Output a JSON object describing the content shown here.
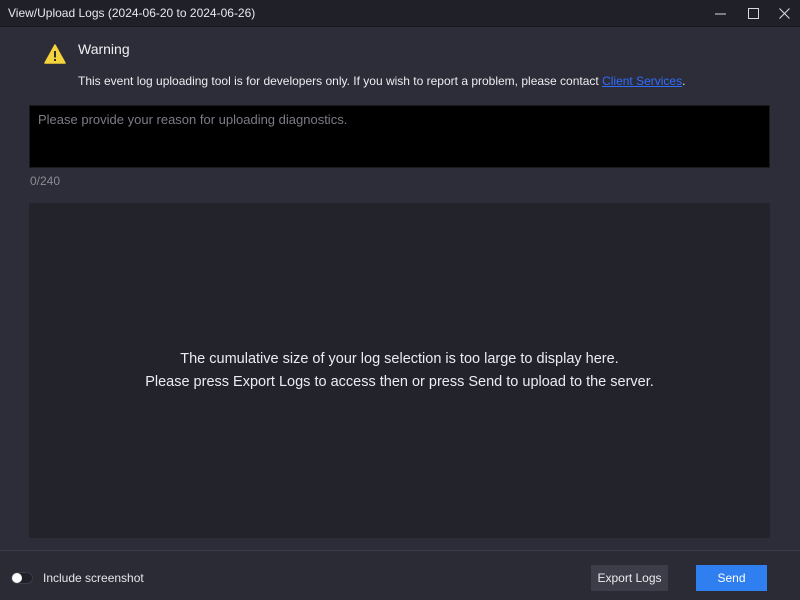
{
  "window": {
    "title": "View/Upload Logs (2024-06-20 to 2024-06-26)",
    "controls": [
      "minimize-icon",
      "maximize-icon",
      "close-icon"
    ]
  },
  "warning": {
    "icon": "warning-triangle-icon",
    "title": "Warning",
    "text_before_link": "This event log uploading tool is for developers only. If you wish to report a problem, please contact ",
    "link_text": "Client Services",
    "text_after_link": ".",
    "icon_color": "#f5d33a",
    "link_color": "#2f6dff"
  },
  "reason": {
    "value": "",
    "placeholder": "Please provide your reason for uploading diagnostics.",
    "counter": "0/240"
  },
  "log_panel": {
    "line1": "The cumulative size of your log selection is too large to display here.",
    "line2": "Please press Export Logs to access then or press Send to upload to the server."
  },
  "footer": {
    "include_screenshot_label": "Include screenshot",
    "include_screenshot_on": false,
    "export_label": "Export Logs",
    "send_label": "Send",
    "send_color": "#2f7ff0"
  }
}
